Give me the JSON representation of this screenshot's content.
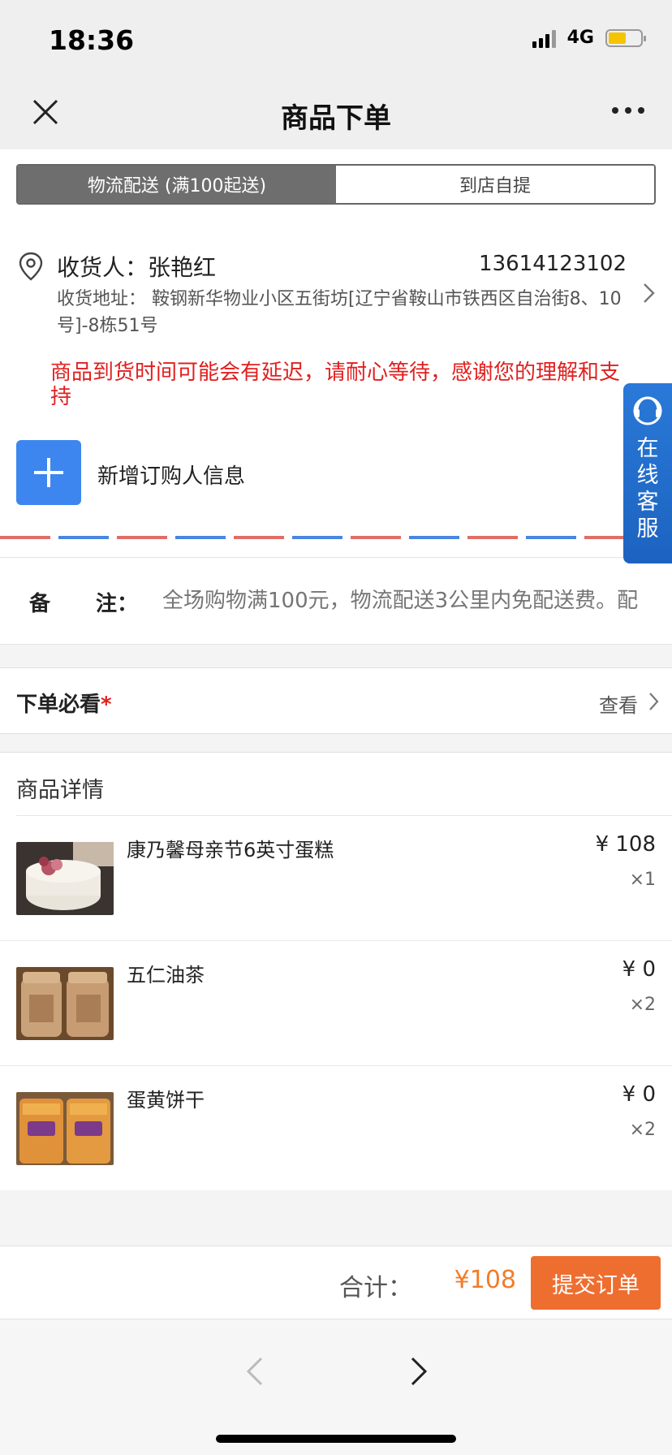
{
  "status": {
    "time": "18:36",
    "network": "4G",
    "battery_level": 0.55
  },
  "nav": {
    "title": "商品下单",
    "close_icon": "close-icon",
    "more_icon": "more-icon"
  },
  "delivery": {
    "options": [
      {
        "label": "物流配送 (满100起送)",
        "selected": true
      },
      {
        "label": "到店自提",
        "selected": false
      }
    ]
  },
  "address": {
    "name": "收货人：张艳红",
    "phone": "13614123102",
    "text": "收货地址： 鞍钢新华物业小区五街坊[辽宁省鞍山市铁西区自治街8、10号]-8栋51号"
  },
  "notice": "商品到货时间可能会有延迟，请耐心等待，感谢您的理解和支持",
  "add_buyer": {
    "label": "新增订购人信息"
  },
  "remark": {
    "label_a": "备",
    "label_b": "注：",
    "placeholder": "全场购物满100元，物流配送3公里内免配送费。配"
  },
  "must_read": {
    "title": "下单必看",
    "required_mark": "*",
    "view": "查看"
  },
  "details": {
    "title": "商品详情",
    "items": [
      {
        "name": "康乃馨母亲节6英寸蛋糕",
        "price": "¥ 108",
        "qty": "×1"
      },
      {
        "name": "五仁油茶",
        "price": "¥ 0",
        "qty": "×2"
      },
      {
        "name": "蛋黄饼干",
        "price": "¥ 0",
        "qty": "×2"
      }
    ]
  },
  "footer": {
    "total_label": "合计：",
    "total_value": "¥108",
    "submit": "提交订单"
  },
  "service": {
    "label": "在线客服"
  },
  "colors": {
    "accent_orange": "#ee6e30",
    "notice_red": "#e02020",
    "add_blue": "#3d86f0",
    "service_blue": "#2a79d8"
  }
}
